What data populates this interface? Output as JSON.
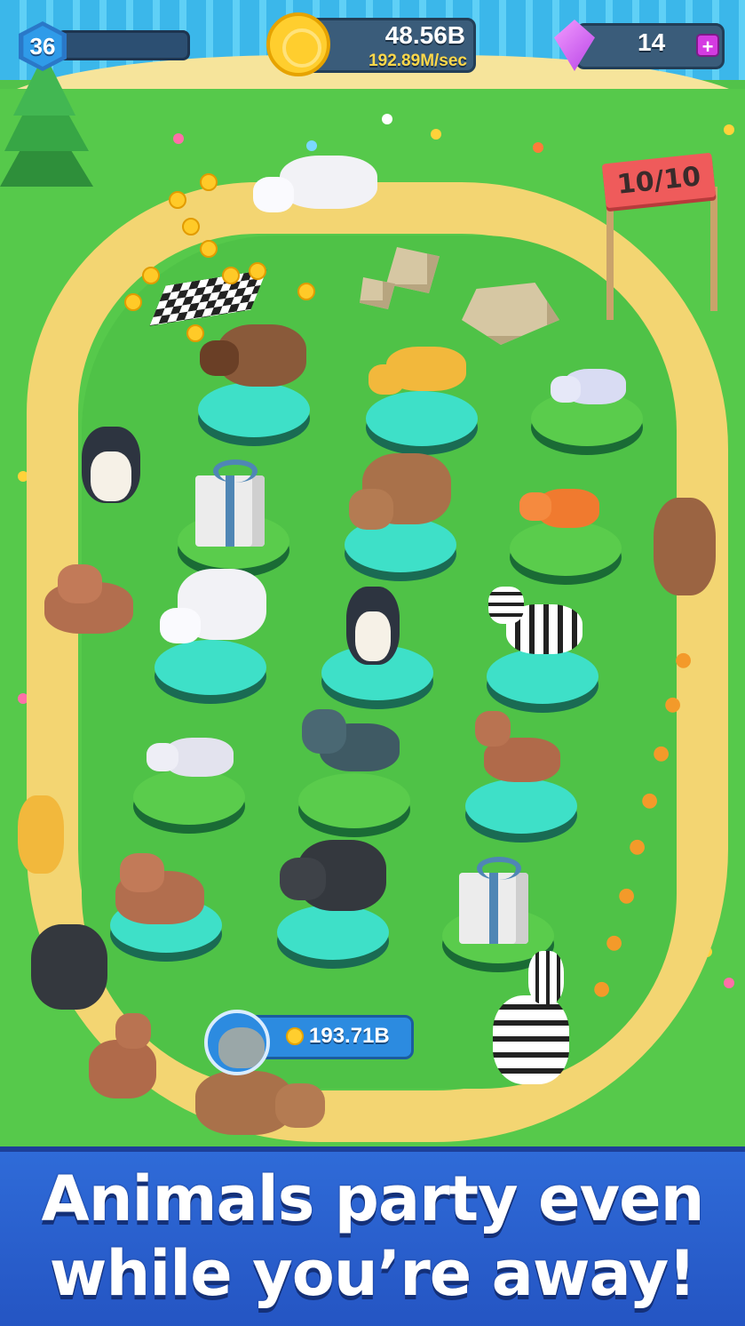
{
  "hud": {
    "level": "36",
    "level_progress": 0.0,
    "coins_total": "48.56B",
    "coins_rate": "192.89M/sec",
    "gems": "14",
    "gem_add_symbol": "+"
  },
  "finish_gate": {
    "lap_label": "10/10"
  },
  "buy_animal": {
    "price": "193.71B",
    "avatar": "hippo-icon"
  },
  "banner": {
    "line1": "Animals party even",
    "line2": "while you’re away!"
  },
  "pedestals": [
    {
      "animal": "musk-ox"
    },
    {
      "animal": "cheetah"
    },
    {
      "animal": "arctic-fox"
    },
    {
      "animal": "gift-box"
    },
    {
      "animal": "bear"
    },
    {
      "animal": "fox"
    },
    {
      "animal": "polar-bear"
    },
    {
      "animal": "penguin"
    },
    {
      "animal": "zebra"
    },
    {
      "animal": "arctic-wolf"
    },
    {
      "animal": "wolf"
    },
    {
      "animal": "deer"
    },
    {
      "animal": "walrus"
    },
    {
      "animal": "buffalo"
    },
    {
      "animal": "gift-box"
    }
  ],
  "colors": {
    "grass": "#56c94b",
    "track": "#f3d572",
    "banner": "#2f6bd8",
    "pedestal": "#3ee0c8"
  }
}
